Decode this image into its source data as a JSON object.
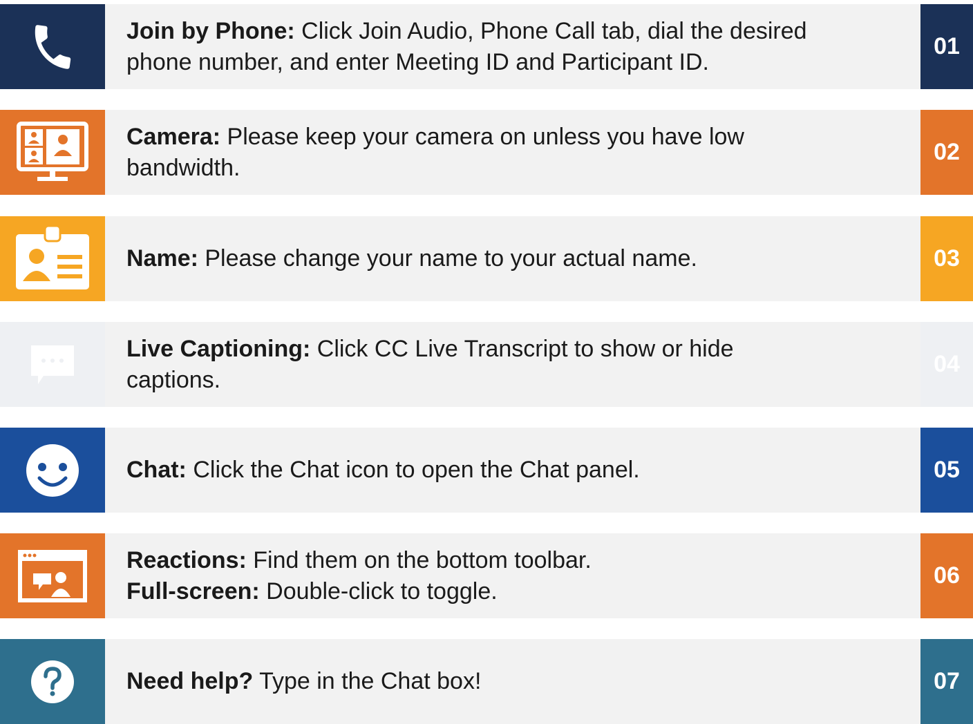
{
  "colors": {
    "row1": "#1b3157",
    "row2": "#e3742a",
    "row3": "#f6a623",
    "row4": "#eef0f3",
    "row5": "#1b4f9c",
    "row6": "#e3742a",
    "row7": "#2e6f8d",
    "text_bg": "#f2f2f2"
  },
  "items": [
    {
      "icon": "phone-icon",
      "bold": "Join by Phone:",
      "text": " Click Join Audio, Phone Call tab, dial the desired",
      "line2_text": "phone number, and enter Meeting ID and Participant ID.",
      "number": "01"
    },
    {
      "icon": "video-call-monitor-icon",
      "bold": "Camera:",
      "text": " Please keep your camera on unless you have low",
      "line2_text": "bandwidth.",
      "number": "02"
    },
    {
      "icon": "id-badge-icon",
      "bold": "Name:",
      "text": " Please change your name to your actual name.",
      "number": "03"
    },
    {
      "icon": "speech-bubble-icon",
      "bold": "Live Captioning:",
      "text": " Click CC Live Transcript to show or hide",
      "line2_text": "captions.",
      "number": "04"
    },
    {
      "icon": "smiley-face-icon",
      "bold": "Chat:",
      "text": " Click the Chat icon to open the Chat panel.",
      "number": "05"
    },
    {
      "icon": "reaction-window-icon",
      "bold": "Reactions:",
      "text": " Find them on the bottom toolbar.",
      "line2_bold": "Full-screen:",
      "line2_text": " Double-click to toggle.",
      "number": "06"
    },
    {
      "icon": "help-question-icon",
      "bold": "Need help?",
      "text": " Type in the Chat box!",
      "number": "07"
    }
  ]
}
